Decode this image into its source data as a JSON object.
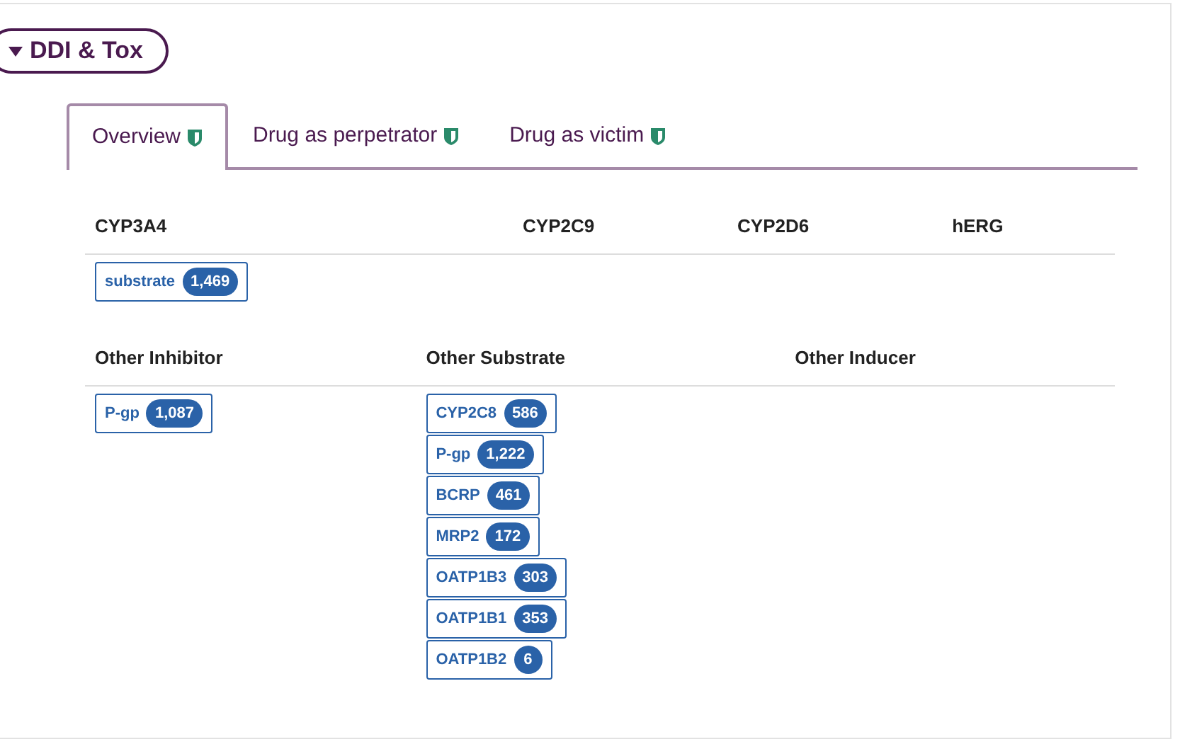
{
  "section": {
    "title": "DDI & Tox",
    "expanded": true
  },
  "tabs": [
    {
      "label": "Overview",
      "selected": true
    },
    {
      "label": "Drug as perpetrator",
      "selected": false
    },
    {
      "label": "Drug as victim",
      "selected": false
    }
  ],
  "groups": [
    {
      "columns": [
        {
          "heading": "CYP3A4",
          "tags": [
            {
              "label": "substrate",
              "count": "1,469"
            }
          ]
        },
        {
          "heading": "CYP2C9"
        },
        {
          "heading": "CYP2D6"
        },
        {
          "heading": "hERG"
        }
      ]
    },
    {
      "columns": [
        {
          "heading": "Other Inhibitor",
          "tags": [
            {
              "label": "P-gp",
              "count": "1,087"
            }
          ]
        },
        {
          "heading": "Other Substrate",
          "tags": [
            {
              "label": "CYP2C8",
              "count": "586"
            },
            {
              "label": "P-gp",
              "count": "1,222"
            },
            {
              "label": "BCRP",
              "count": "461"
            },
            {
              "label": "MRP2",
              "count": "172"
            },
            {
              "label": "OATP1B3",
              "count": "303"
            },
            {
              "label": "OATP1B1",
              "count": "353"
            },
            {
              "label": "OATP1B2",
              "count": "6"
            }
          ]
        },
        {
          "heading": "Other Inducer"
        }
      ]
    }
  ]
}
